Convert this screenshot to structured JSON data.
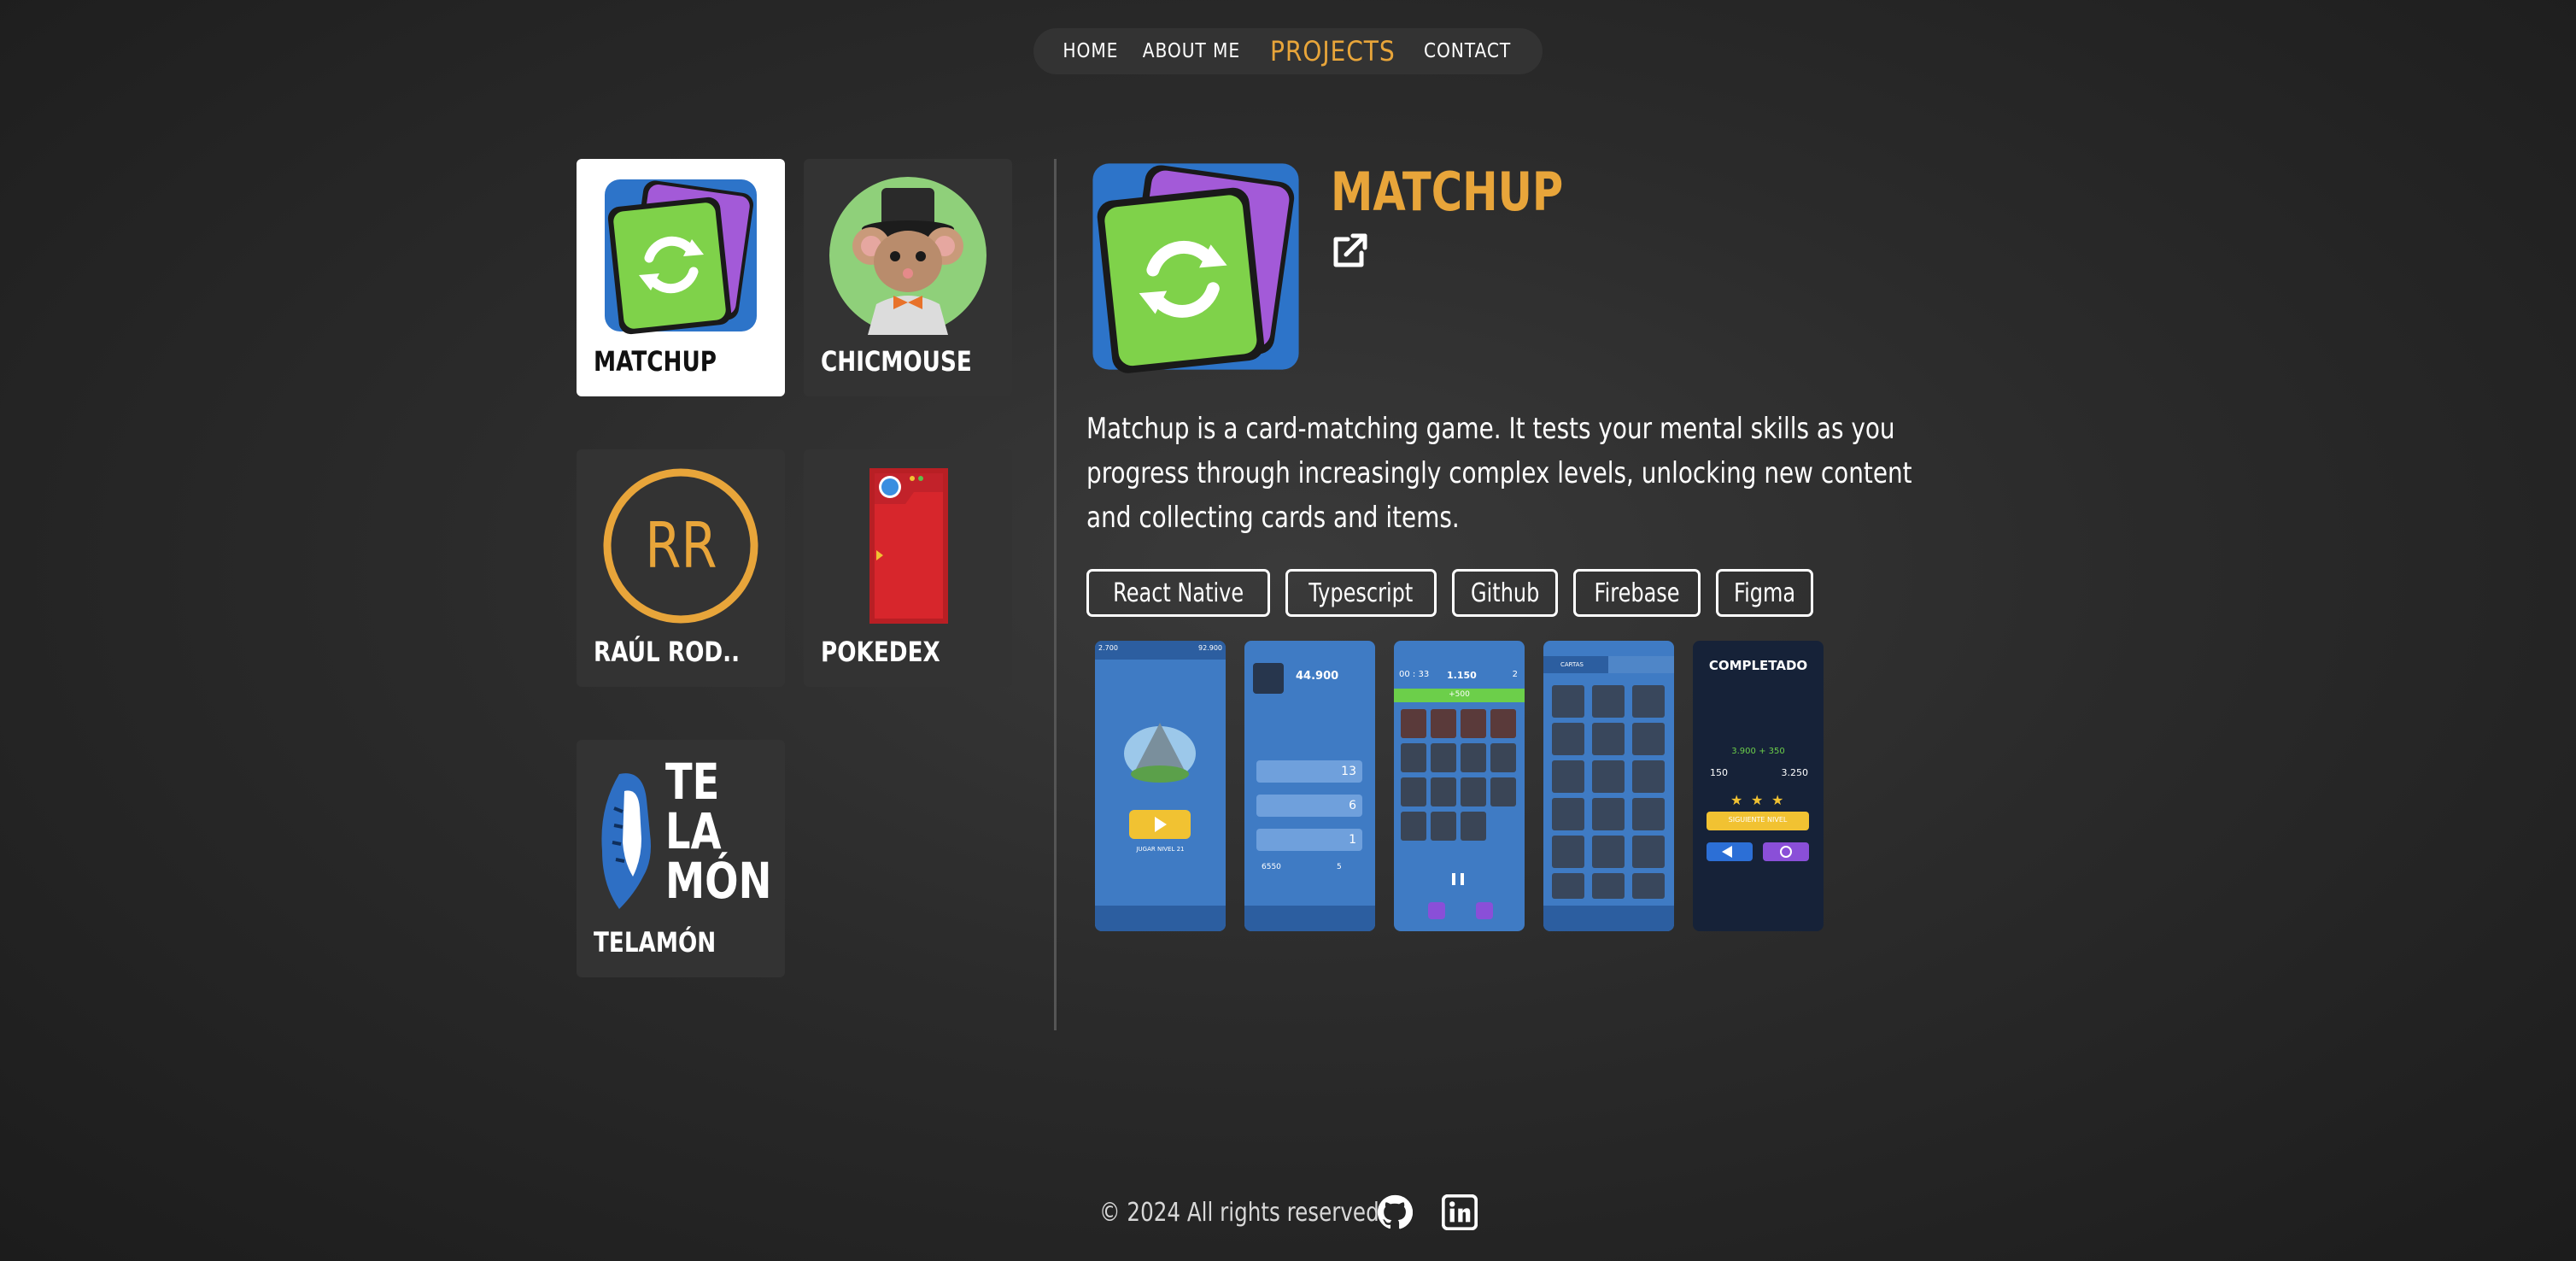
{
  "nav": {
    "items": [
      {
        "label": "HOME"
      },
      {
        "label": "ABOUT ME"
      },
      {
        "label": "PROJECTS",
        "active": true
      },
      {
        "label": "CONTACT"
      }
    ]
  },
  "projects": [
    {
      "label": "MATCHUP",
      "icon": "matchup-icon",
      "selected": true
    },
    {
      "label": "CHICMOUSE",
      "icon": "mouse-icon"
    },
    {
      "label": "RAÚL ROD..",
      "icon": "rr-logo-icon",
      "logo_text": "RR"
    },
    {
      "label": "POKEDEX",
      "icon": "pokedex-icon"
    },
    {
      "label": "TELAMÓN",
      "icon": "telamon-logo-icon",
      "logo_text": [
        "TE",
        "LA",
        "MÓN"
      ]
    }
  ],
  "detail": {
    "title": "MATCHUP",
    "icon": "matchup-icon",
    "link_icon": "external-link-icon",
    "description": "Matchup is a card-matching game. It tests your mental skills as you progress through increasingly complex levels, unlocking new content and collecting cards and items.",
    "tags": [
      "React Native",
      "Typescript",
      "Github",
      "Firebase",
      "Figma"
    ],
    "screenshots": [
      {
        "name": "level-select",
        "texts": [
          "2.700",
          "92.900",
          "JUGAR NIVEL 21"
        ]
      },
      {
        "name": "stats",
        "texts": [
          "44.900",
          "13",
          "6",
          "1",
          "6550",
          "5"
        ]
      },
      {
        "name": "gameplay",
        "texts": [
          "00 : 33",
          "1.150",
          "2",
          "+500"
        ]
      },
      {
        "name": "cards",
        "texts": [
          "CARTAS"
        ]
      },
      {
        "name": "completed",
        "texts": [
          "COMPLETADO",
          "150",
          "3.250",
          "3.900 + 350",
          "SIGUIENTE NIVEL"
        ]
      }
    ]
  },
  "footer": {
    "text": "© 2024 All rights reserved.",
    "icons": [
      "github-icon",
      "linkedin-icon"
    ]
  },
  "colors": {
    "accent": "#e8a53a",
    "card_bg": "#333333",
    "selected_bg": "#ffffff"
  }
}
